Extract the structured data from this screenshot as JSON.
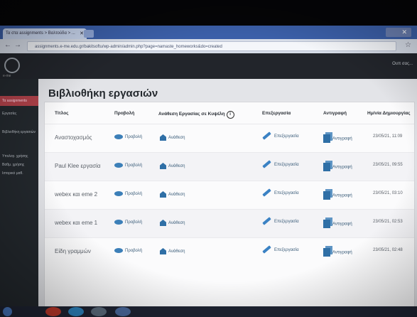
{
  "browser": {
    "tab_title": "Τα στα assignments > Βαλτούδα > ...",
    "url": "assignments.e-me.edu.gr/bakitsoftu/wp-admin/admin.php?page=namaste_homeworks&do=created"
  },
  "adminbar": {
    "greeting": "Ουπ σας...",
    "site": "e-me"
  },
  "sidebar": {
    "active": "Τα assignments",
    "items": [
      "Εργασίες",
      "Βιβλιοθήκη εργασιών",
      "Υπολογ. χρήσης",
      "Βαθμ. χρήσης",
      "Ιστορικό μαθ."
    ]
  },
  "page": {
    "title": "Βιβλιοθήκη εργασιών"
  },
  "table": {
    "headers": {
      "title": "Τίτλος",
      "preview": "Προβολή",
      "assign": "Ανάθεση Εργασίας σε Κυψέλη",
      "edit": "Επεξεργασία",
      "copy": "Αντιγραφή",
      "date": "Ημ/νία Δημιουργίας"
    },
    "info_icon": "i",
    "rows": [
      {
        "title": "Αναστοχασμός",
        "preview": "Προβολή",
        "assign": "Ανάθεση",
        "edit": "Επεξεργασία",
        "copy": "Αντιγραφή",
        "date": "23/05/21, 11:09"
      },
      {
        "title": "Paul Klee εργασία",
        "preview": "Προβολή",
        "assign": "Ανάθεση",
        "edit": "Επεξεργασία",
        "copy": "Αντιγραφή",
        "date": "23/05/21, 09:55"
      },
      {
        "title": "webex και eme 2",
        "preview": "Προβολή",
        "assign": "Ανάθεση",
        "edit": "Επεξεργασία",
        "copy": "Αντιγραφή",
        "date": "23/05/21, 03:10"
      },
      {
        "title": "webex και eme 1",
        "preview": "Προβολή",
        "assign": "Ανάθεση",
        "edit": "Επεξεργασία",
        "copy": "Αντιγραφή",
        "date": "23/05/21, 02:53"
      },
      {
        "title": "Είδη γραμμών",
        "preview": "Προβολή",
        "assign": "Ανάθεση",
        "edit": "Επεξεργασία",
        "copy": "Αντιγραφή",
        "date": "23/05/21, 02:48"
      }
    ]
  },
  "icons": {
    "preview": "eye-icon",
    "assign": "share-icon",
    "edit": "pencil-icon",
    "copy": "copy-icon"
  },
  "colors": {
    "accent": "#3b82c4",
    "sidebar_active": "#b0424a",
    "adminbar": "#22252b"
  }
}
